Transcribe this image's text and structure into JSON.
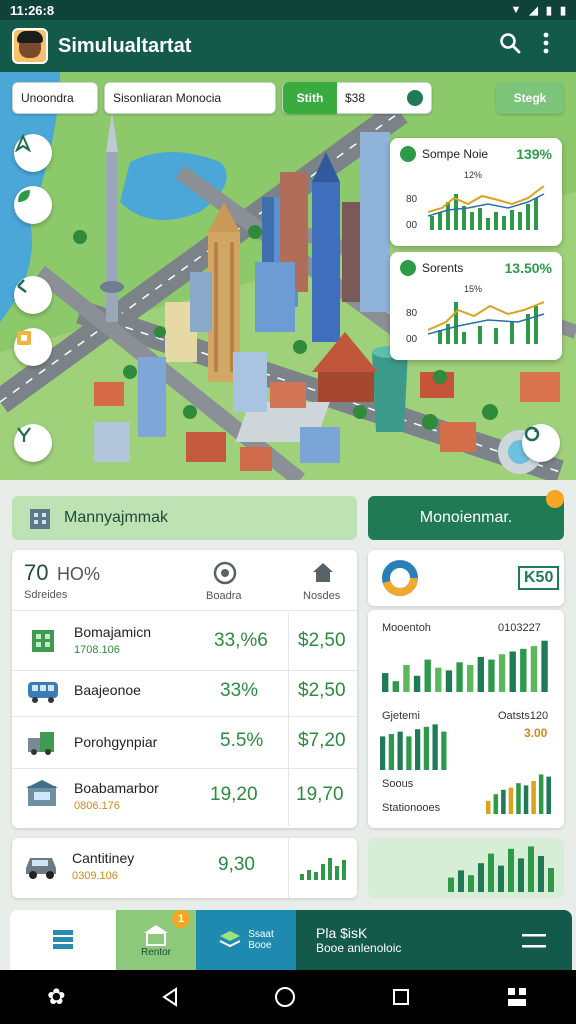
{
  "status": {
    "time": "11:26:8",
    "extra": "8"
  },
  "appbar": {
    "title": "Simulualtartat",
    "search_icon": "search-icon",
    "menu_icon": "more-vert-icon"
  },
  "map_controls": {
    "chip1": "Unoondra",
    "search_placeholder": "Sisonliaran Monocia",
    "toggle_label": "Stith",
    "toggle_value": "$38",
    "button_right": "Stegk"
  },
  "stat_cards": [
    {
      "title": "Sompe Noie",
      "pct": "139%",
      "sub": "12%",
      "y_labels": [
        "80",
        "00"
      ]
    },
    {
      "title": "Sorents",
      "pct": "13.50%",
      "sub": "15%",
      "y_labels": [
        "80",
        "00"
      ]
    }
  ],
  "management": {
    "header_left": "Mannyajmmak",
    "header_right": "Monoienmar.",
    "header_right_badge": "",
    "summary": {
      "value": "70",
      "pct": "HO%",
      "label": "Sdreides",
      "col2": "Boadra",
      "col3": "Nosdes"
    },
    "rows": [
      {
        "name": "Bomajamicn",
        "sub": "1708.106",
        "pct": "33,%6",
        "price": "$2,50"
      },
      {
        "name": "Baajeonoe",
        "sub": "",
        "pct": "33%",
        "price": "$2,50"
      },
      {
        "name": "Porohgynpiar",
        "sub": "",
        "pct": "5.5%",
        "price": "$7,20"
      },
      {
        "name": "Boabamarbor",
        "sub": "0806.176",
        "pct": "19,20",
        "price": "19,70"
      }
    ],
    "bottom_row": {
      "name": "Cantitiney",
      "sub": "0309.106",
      "value": "9,30"
    }
  },
  "right_panel": {
    "donut_value": "K50",
    "chart1_label": "Mooentoh",
    "chart1_value": "0103227",
    "chart2_label": "Gjetemi",
    "chart2_value": "Oatsts120",
    "chart2_sub": "3.00",
    "chart3_label": "Soous",
    "chart3_sub": "Stationooes",
    "chart1_bars": [
      0.35,
      0.2,
      0.5,
      0.3,
      0.6,
      0.45,
      0.4,
      0.55,
      0.5,
      0.65,
      0.6,
      0.7,
      0.75,
      0.8,
      0.85,
      0.95
    ],
    "chart2_bars": [
      0.7,
      0.75,
      0.8,
      0.7,
      0.85,
      0.9,
      0.95,
      0.8
    ],
    "chart3_bars": [
      0.3,
      0.45,
      0.55,
      0.6,
      0.7,
      0.65,
      0.75,
      0.9,
      0.85
    ],
    "chart4_bars": [
      0.3,
      0.45,
      0.35,
      0.6,
      0.8,
      0.55,
      0.9,
      0.7,
      0.95,
      0.75,
      0.5
    ]
  },
  "bottom_nav": {
    "item2": "Rentor",
    "item2_badge": "1",
    "item3_top": "Ssaat",
    "item3_bottom": "Booe",
    "item4_title": "Pla $isK",
    "item4_sub": "Booe anlenoloic"
  },
  "colors": {
    "primary": "#145a4b",
    "accent_green": "#2d9a4a",
    "orange": "#f5a623"
  }
}
